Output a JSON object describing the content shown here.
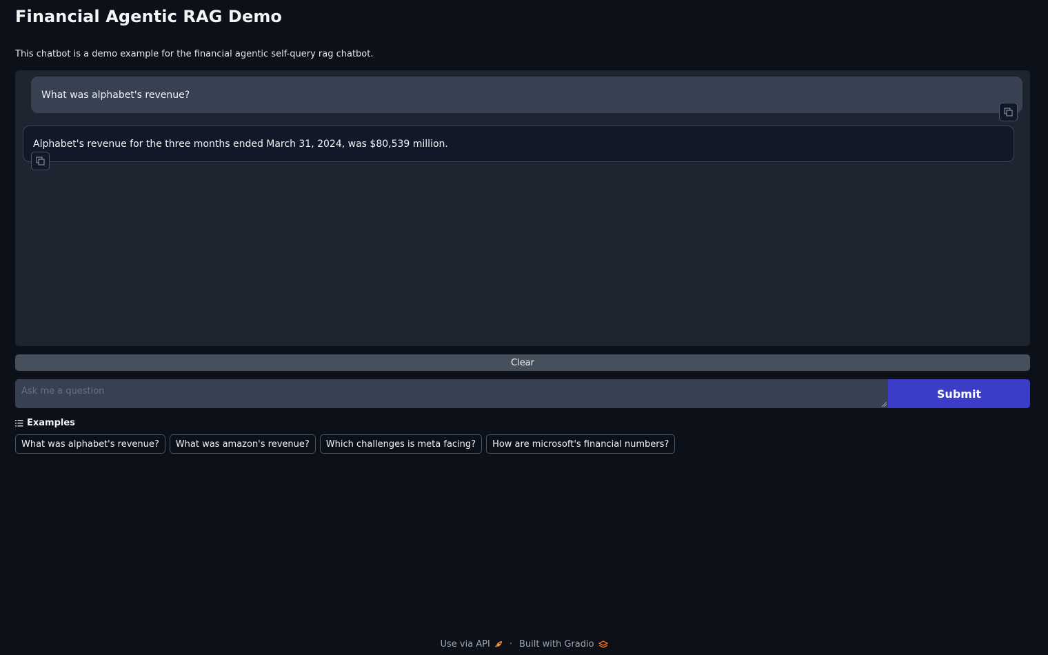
{
  "header": {
    "title": "Financial Agentic RAG Demo",
    "description": "This chatbot is a demo example for the financial agentic self-query rag chatbot."
  },
  "chat": {
    "messages": [
      {
        "role": "user",
        "text": "What was alphabet's revenue?"
      },
      {
        "role": "assistant",
        "text": "Alphabet's revenue for the three months ended March 31, 2024, was $80,539 million."
      }
    ]
  },
  "controls": {
    "clear_label": "Clear",
    "input_placeholder": "Ask me a question",
    "input_value": "",
    "submit_label": "Submit"
  },
  "examples": {
    "label": "Examples",
    "items": [
      "What was alphabet's revenue?",
      "What was amazon's revenue?",
      "Which challenges is meta facing?",
      "How are microsoft's financial numbers?"
    ]
  },
  "footer": {
    "api_label": "Use via API",
    "separator": "·",
    "built_label": "Built with Gradio"
  },
  "colors": {
    "background": "#0c1018",
    "chat_panel": "#1f2530",
    "user_bubble": "#374151",
    "bot_bubble": "#111827",
    "submit": "#3b3dc9",
    "gradio_accent": "#f97316"
  },
  "icons": {
    "copy": "copy-icon",
    "examples": "list-icon",
    "api": "rocket-icon",
    "gradio": "gradio-logo-icon"
  }
}
